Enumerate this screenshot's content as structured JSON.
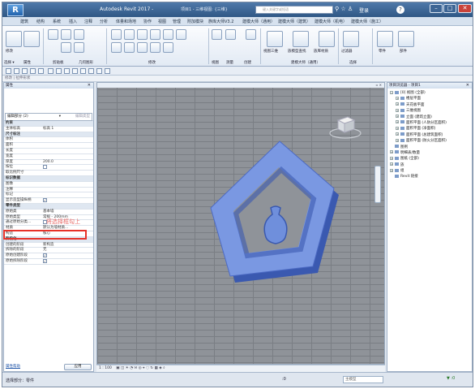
{
  "titlebar": {
    "app_title": "Autodesk Revit 2017 -",
    "file": "项目1 - 三维视图: {三维}",
    "search_placeholder": "键入关键字或短语",
    "login": "登录",
    "help": "?"
  },
  "tabs": [
    "建筑",
    "结构",
    "系统",
    "插入",
    "注释",
    "分析",
    "体量和场地",
    "协作",
    "视图",
    "管理",
    "附加模块",
    "族库大师V3.2",
    "建模大师（通用）",
    "建模大师（建筑）",
    "建模大师（机电）",
    "建模大师（施工）"
  ],
  "ribbon": {
    "groups": [
      {
        "label": "选择 ▾"
      },
      {
        "label": "属性"
      },
      {
        "label": "剪贴板"
      },
      {
        "label": "几何图形"
      },
      {
        "label": "修改"
      },
      {
        "label": "视图"
      },
      {
        "label": "测量"
      },
      {
        "label": "创建"
      },
      {
        "label": "建模大师（通用）"
      },
      {
        "label": "选择"
      }
    ],
    "buttons": [
      {
        "label": "修改"
      },
      {
        "label": "属性"
      },
      {
        "label": "视图三维"
      },
      {
        "label": "族模型查找"
      },
      {
        "label": "族库材质"
      },
      {
        "label": "过滤器"
      },
      {
        "label": "零件"
      },
      {
        "label": "部件"
      }
    ]
  },
  "options_bar": "修改 | 拉伸形状",
  "properties": {
    "title": "属性",
    "type_selector": "编辑部分 (2)",
    "edit_type": "编辑类型",
    "rows": [
      {
        "group": "约束"
      },
      {
        "name": "主体标高",
        "value": "标高 1"
      },
      {
        "group": "尺寸标注"
      },
      {
        "name": "体积",
        "value": ""
      },
      {
        "name": "面积",
        "value": ""
      },
      {
        "name": "长度",
        "value": ""
      },
      {
        "name": "宽度",
        "value": ""
      },
      {
        "name": "厚度",
        "value": "200.0"
      },
      {
        "name": "按位",
        "value": "",
        "check": ""
      },
      {
        "name": "取比例尺寸",
        "value": ""
      },
      {
        "group": "标识数据"
      },
      {
        "name": "图像",
        "value": ""
      },
      {
        "name": "注释",
        "value": ""
      },
      {
        "name": "标记",
        "value": ""
      },
      {
        "name": "显示造型操纵柄",
        "value": "",
        "check": "✓"
      },
      {
        "group": "零件类型"
      },
      {
        "name": "原始类",
        "value": "基本墙"
      },
      {
        "name": "原始类型",
        "value": "常规 - 200mm"
      },
      {
        "name": "通过原始分类...",
        "value": "",
        "check": ""
      },
      {
        "name": "材质",
        "value": "默认为墙材质..."
      },
      {
        "name": "构造",
        "value": "核心"
      },
      {
        "group": "阶段化"
      },
      {
        "name": "创建的阶段",
        "value": "新构造"
      },
      {
        "name": "拆除的阶段",
        "value": "无"
      },
      {
        "name": "原始创建阶段",
        "value": "",
        "check": "✓"
      },
      {
        "name": "原始拆除阶段",
        "value": "",
        "check": "✓"
      }
    ],
    "help_link": "属性帮助",
    "apply": "应用"
  },
  "annotation": "将选择框勾上",
  "view": {
    "title": "项目浏览器 - 项目1",
    "scale": "1 : 100"
  },
  "browser": {
    "title": "项目浏览器 - 项目1",
    "nodes": [
      {
        "level": 0,
        "exp": "−",
        "label": "[0] 视图 (全部)"
      },
      {
        "level": 1,
        "exp": "+",
        "label": "楼层平面"
      },
      {
        "level": 1,
        "exp": "+",
        "label": "天花板平面"
      },
      {
        "level": 1,
        "exp": "+",
        "label": "三维视图"
      },
      {
        "level": 1,
        "exp": "+",
        "label": "立面 (建筑立面)"
      },
      {
        "level": 1,
        "exp": "+",
        "label": "面积平面 (人防分区面积)"
      },
      {
        "level": 1,
        "exp": "+",
        "label": "面积平面 (净面积)"
      },
      {
        "level": 1,
        "exp": "+",
        "label": "面积平面 (总建筑面积)"
      },
      {
        "level": 1,
        "exp": "+",
        "label": "面积平面 (防火分区面积)"
      },
      {
        "level": 0,
        "exp": "",
        "label": "图例"
      },
      {
        "level": 0,
        "exp": "+",
        "label": "明细表/数量"
      },
      {
        "level": 0,
        "exp": "+",
        "label": "图纸 (全部)"
      },
      {
        "level": 0,
        "exp": "+",
        "label": "族"
      },
      {
        "level": 0,
        "exp": "+",
        "label": "组"
      },
      {
        "level": 0,
        "exp": "",
        "label": "Revit 链接"
      }
    ]
  },
  "status": {
    "text": "选择部分：零件",
    "zero": ":0",
    "filter": "主模型"
  },
  "colors": {
    "model_face": "#6f8fdc",
    "model_edge": "#3a59b0",
    "accent": "#2f5785",
    "highlight": "#e63229"
  }
}
